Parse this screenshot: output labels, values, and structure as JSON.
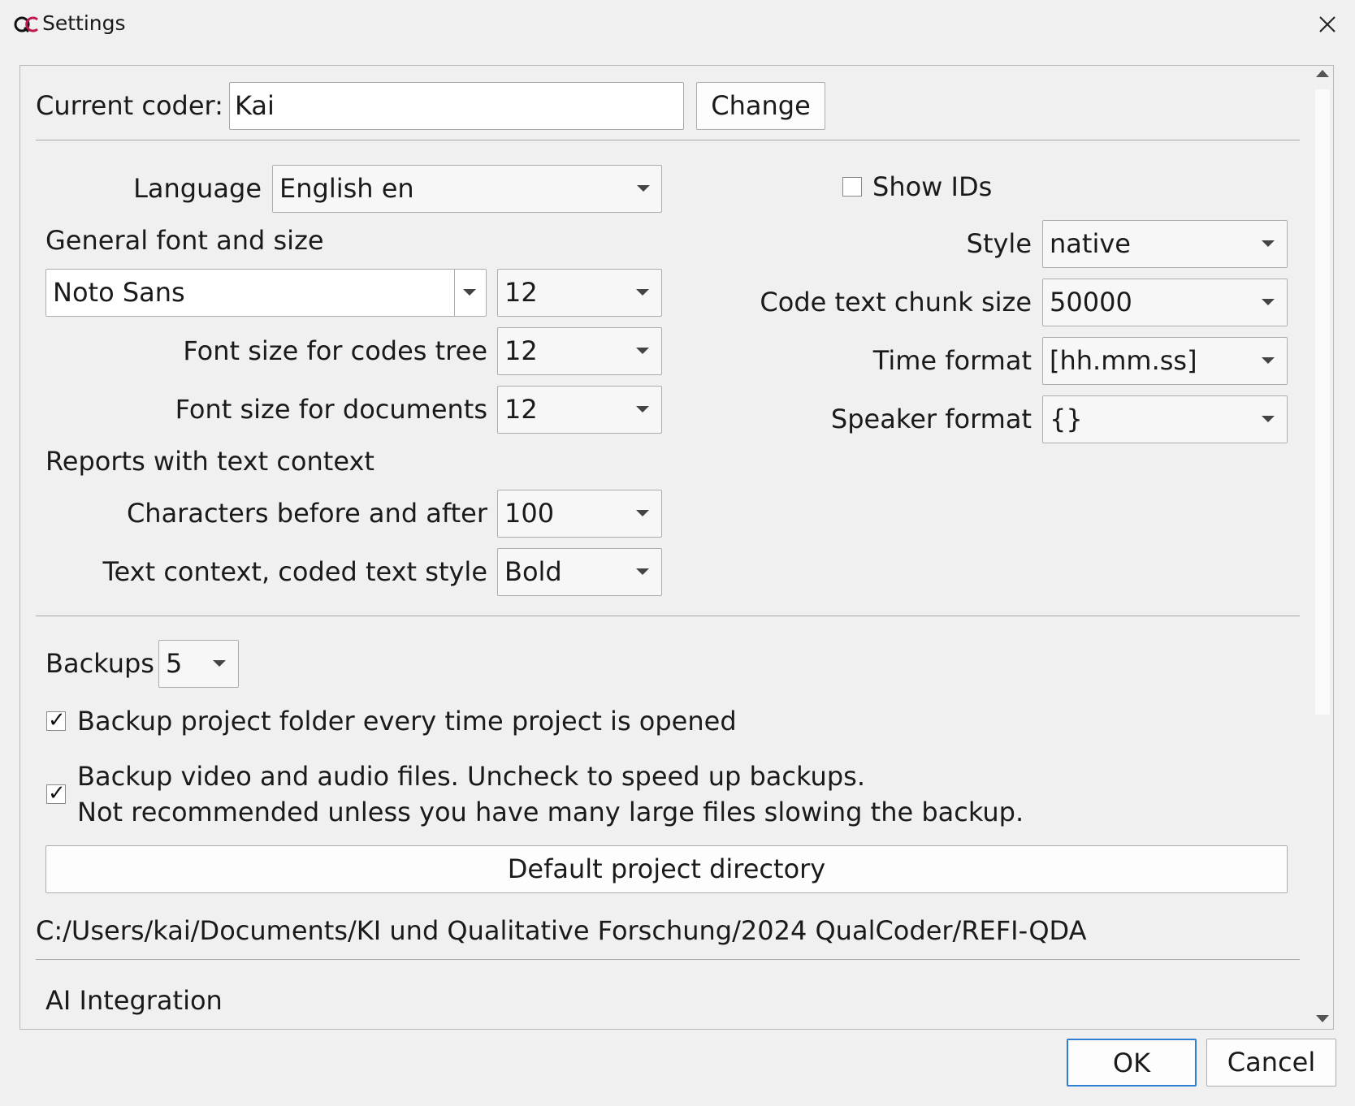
{
  "window": {
    "title": "Settings",
    "logo_icon": "qualcoder-logo-icon",
    "close_icon": "close-icon"
  },
  "coder": {
    "label": "Current coder:",
    "value": "Kai",
    "change_button": "Change"
  },
  "general": {
    "language_label": "Language",
    "language_value": "English en",
    "font_section_label": "General font and size",
    "font_family_value": "Noto Sans",
    "font_size_value": "12",
    "codes_tree_label": "Font size for codes tree",
    "codes_tree_value": "12",
    "documents_label": "Font size for documents",
    "documents_value": "12",
    "reports_section_label": "Reports with text context",
    "chars_label": "Characters before and after",
    "chars_value": "100",
    "context_style_label": "Text context, coded text style",
    "context_style_value": "Bold"
  },
  "right": {
    "show_ids_label": "Show IDs",
    "show_ids_checked": false,
    "style_label": "Style",
    "style_value": "native",
    "chunk_label": "Code text chunk size",
    "chunk_value": "50000",
    "time_format_label": "Time format",
    "time_format_value": "[hh.mm.ss]",
    "speaker_format_label": "Speaker format",
    "speaker_format_value": "{}"
  },
  "backups": {
    "label": "Backups",
    "value": "5",
    "backup_folder_label": "Backup project folder every time project is opened",
    "backup_folder_checked": true,
    "backup_av_line1": "Backup video and audio files. Uncheck to speed up backups.",
    "backup_av_line2": "Not recommended unless you have many large files slowing the backup.",
    "backup_av_checked": true,
    "default_dir_button": "Default project directory",
    "directory_path": "C:/Users/kai/Documents/KI und Qualitative Forschung/2024 QualCoder/REFI-QDA"
  },
  "ai": {
    "section_label": "AI Integration"
  },
  "footer": {
    "ok_button": "OK",
    "cancel_button": "Cancel"
  },
  "colors": {
    "background": "#f0f0f0",
    "ok_focus_border": "#2f7fd3"
  }
}
